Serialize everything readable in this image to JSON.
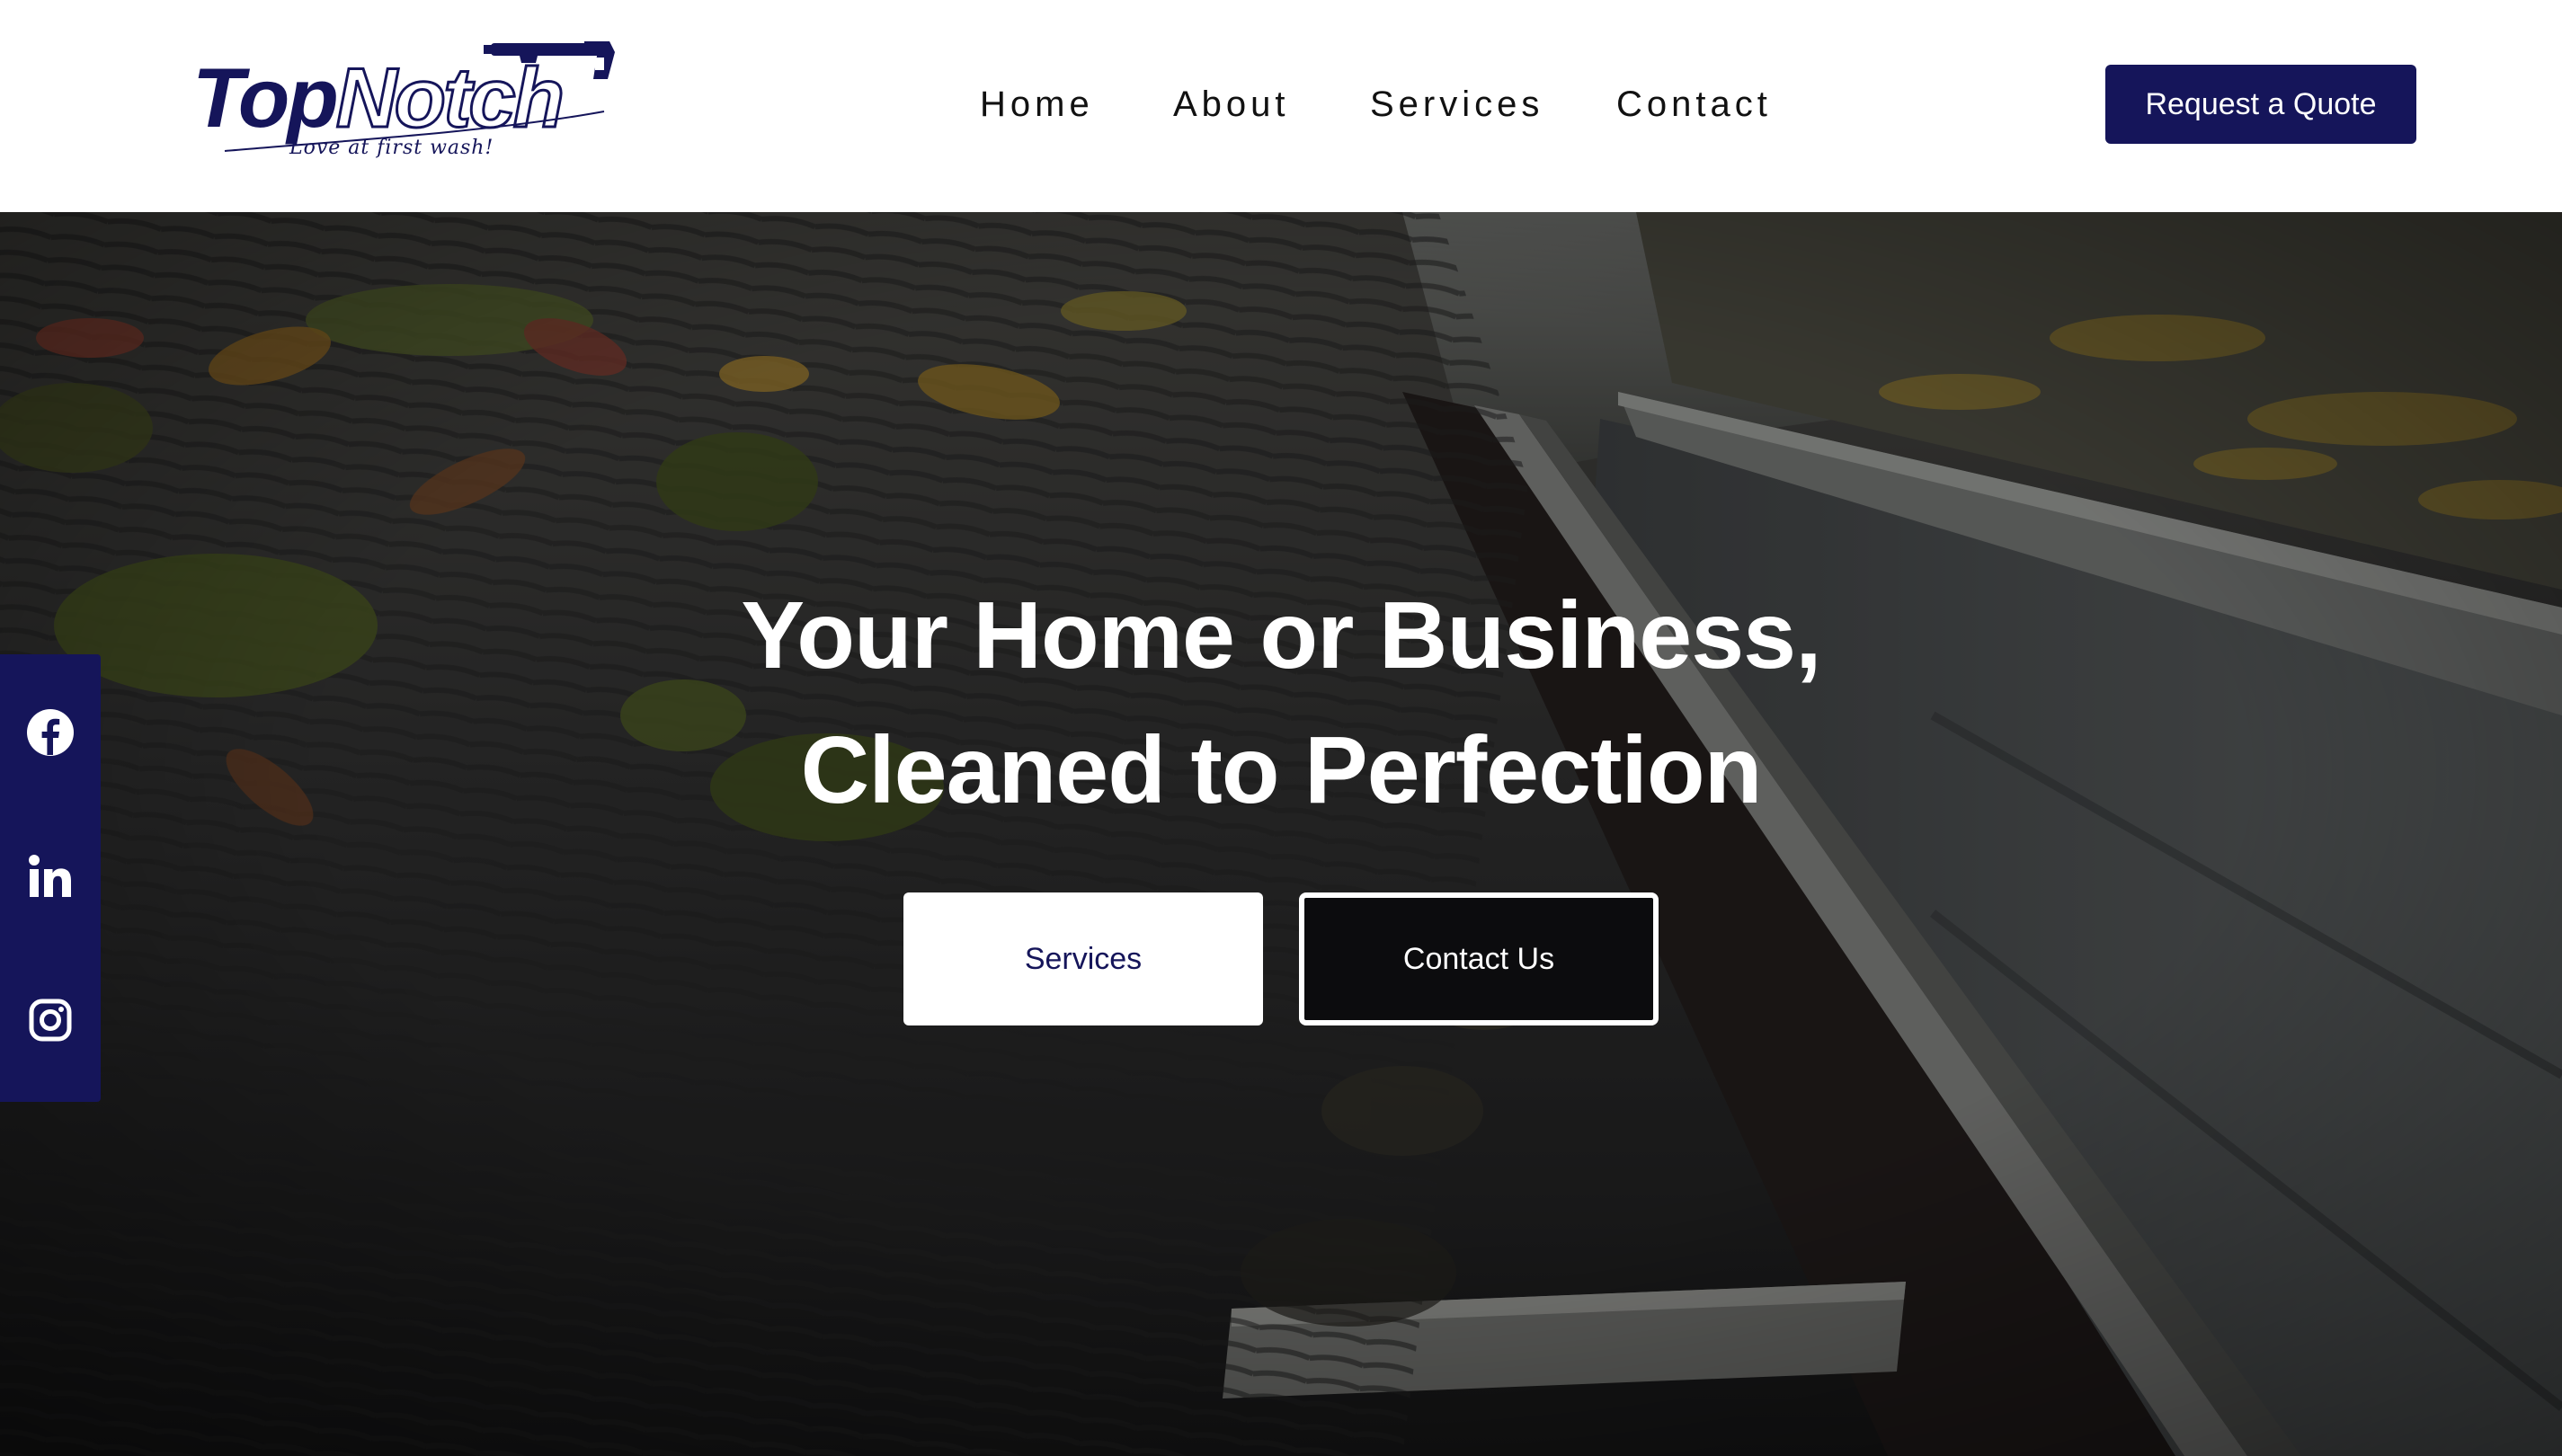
{
  "brand": {
    "logo_top": "Top",
    "logo_notch": "Notch",
    "tagline": "Love at first wash!",
    "primary_color": "#15155a"
  },
  "nav": {
    "items": [
      {
        "label": "Home"
      },
      {
        "label": "About"
      },
      {
        "label": "Services"
      },
      {
        "label": "Contact"
      }
    ],
    "cta_label": "Request a Quote"
  },
  "hero": {
    "title_line1": "Your Home or Business,",
    "title_line2": "Cleaned to Perfection",
    "primary_button": "Services",
    "secondary_button": "Contact Us",
    "background": "roof-gutter-photo"
  },
  "social": {
    "items": [
      {
        "name": "facebook",
        "icon": "facebook-icon"
      },
      {
        "name": "linkedin",
        "icon": "linkedin-icon"
      },
      {
        "name": "instagram",
        "icon": "instagram-icon"
      }
    ]
  }
}
